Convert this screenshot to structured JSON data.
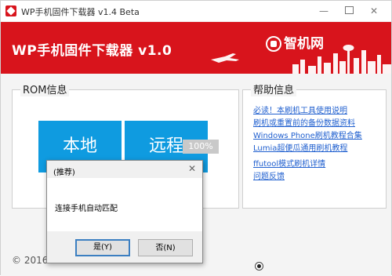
{
  "window": {
    "title": "WP手机固件下载器 v1.4 Beta",
    "controls": {
      "minimize": "—",
      "close": "✕"
    }
  },
  "header": {
    "title": "WP手机固件下载器 v1.0",
    "brand": "智机网",
    "colors": {
      "background": "#d8141c"
    }
  },
  "rom": {
    "group_title": "ROM信息",
    "local_label": "本地",
    "remote_label": "远程",
    "progress_label": "100%",
    "progress": 100
  },
  "help": {
    "group_title": "帮助信息",
    "links": [
      "必读！本刷机工具使用说明",
      "刷机或重置前的备份数据资料",
      "Windows Phone刷机教程合集",
      "Lumia超便瓜通用刷机教程",
      "ffutool模式刷机详情",
      "问题反馈"
    ]
  },
  "footer": {
    "copyright": "© 2016"
  },
  "dialog": {
    "title": "(推荐)",
    "close": "✕",
    "message": "连接手机自动匹配",
    "yes_label": "是(Y)",
    "no_label": "否(N)"
  },
  "colors": {
    "accent": "#0f9be0",
    "link": "#1f5fcf"
  }
}
